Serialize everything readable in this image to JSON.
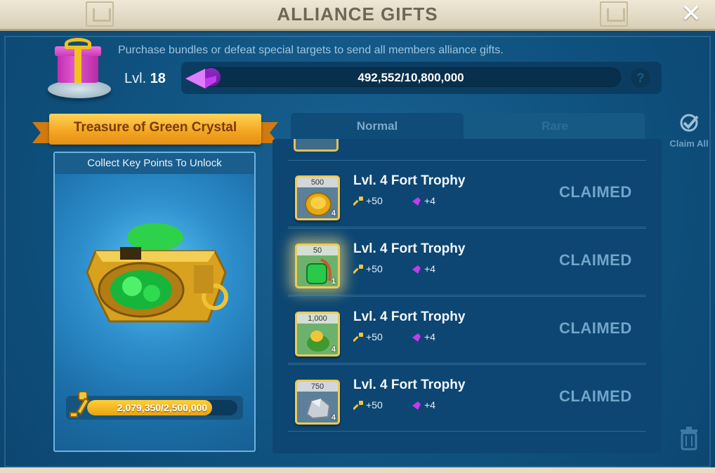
{
  "header": {
    "title": "ALLIANCE GIFTS",
    "close_label": "✕"
  },
  "gift": {
    "description": "Purchase bundles or defeat special targets to send all members alliance gifts.",
    "level_prefix": "Lvl.",
    "level": "18",
    "progress_text": "492,552/10,800,000",
    "progress_fraction": 0.0456,
    "help_label": "?"
  },
  "treasure": {
    "name": "Treasure of Green Crystal",
    "subtitle": "Collect Key Points To Unlock",
    "key_progress_text": "2,079,350/2,500,000",
    "key_progress_fraction": 0.8317
  },
  "tabs": [
    {
      "label": "Normal",
      "active": true
    },
    {
      "label": "Rare",
      "active": false
    }
  ],
  "rows": [
    {
      "title": "Lvl. 4 Fort Trophy",
      "qty": "500",
      "count": "4",
      "icon": "gold-coin-icon",
      "keys": "+50",
      "gems": "+4",
      "status": "CLAIMED"
    },
    {
      "title": "Lvl. 4 Fort Trophy",
      "qty": "50",
      "count": "1",
      "icon": "green-potion-icon",
      "keys": "+50",
      "gems": "+4",
      "status": "CLAIMED"
    },
    {
      "title": "Lvl. 4 Fort Trophy",
      "qty": "1,000",
      "count": "4",
      "icon": "corn-food-icon",
      "keys": "+50",
      "gems": "+4",
      "status": "CLAIMED"
    },
    {
      "title": "Lvl. 4 Fort Trophy",
      "qty": "750",
      "count": "4",
      "icon": "stone-icon",
      "keys": "+50",
      "gems": "+4",
      "status": "CLAIMED"
    }
  ],
  "side": {
    "claim_all_label": "Claim All"
  },
  "colors": {
    "panel": "#0f517e",
    "accent_gold": "#f3a420",
    "gem_purple": "#b02fe0",
    "claimed_text": "#72a5c8"
  }
}
